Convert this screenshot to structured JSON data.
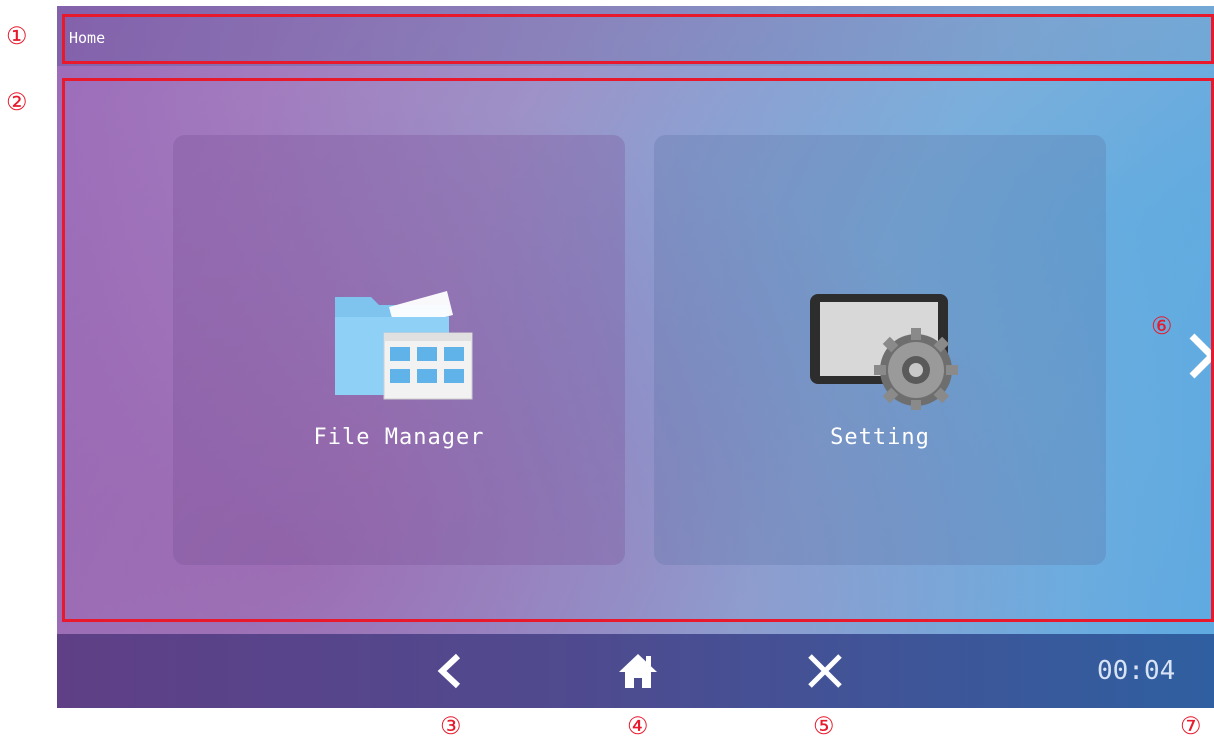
{
  "screen": {
    "title": "Home",
    "tiles": [
      {
        "label": "File Manager",
        "icon": "folder-icon"
      },
      {
        "label": "Setting",
        "icon": "gear-icon"
      }
    ],
    "next_icon": "chevron-right-icon",
    "bottom_bar": {
      "back_icon": "chevron-left-icon",
      "home_icon": "home-icon",
      "close_icon": "close-icon",
      "clock": "00:04"
    }
  },
  "annotations": {
    "n1": "①",
    "n2": "②",
    "n3": "③",
    "n4": "④",
    "n5": "⑤",
    "n6": "⑥",
    "n7": "⑦",
    "color": "#e8192c"
  }
}
